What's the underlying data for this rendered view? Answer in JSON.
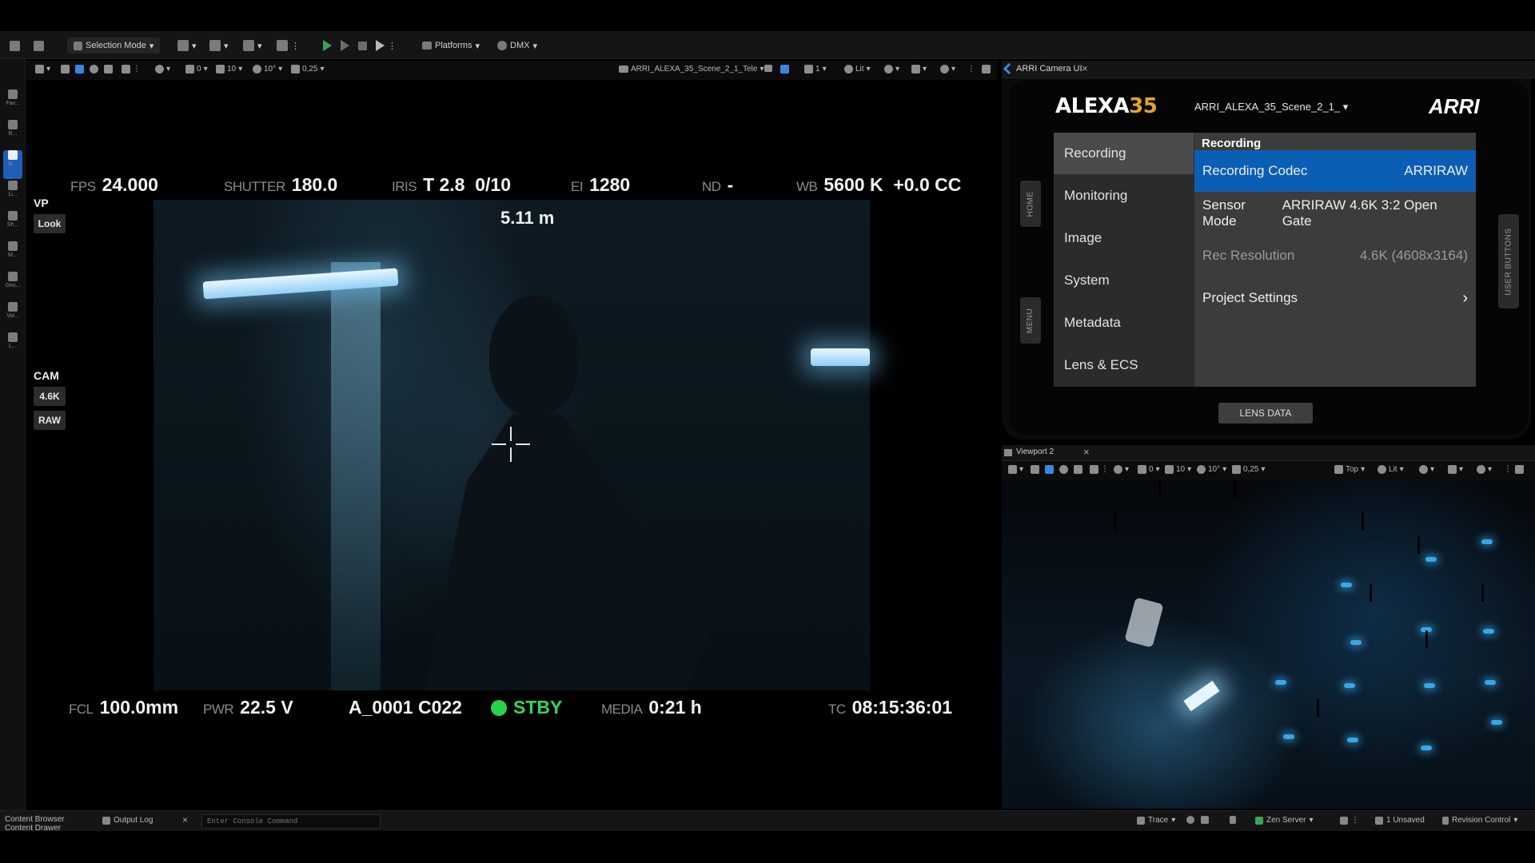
{
  "toolbar": {
    "selection_mode": "Selection Mode",
    "platforms": "Platforms",
    "dmx": "DMX"
  },
  "vp_toolbar": {
    "rot_snap": "0",
    "grid_snap": "10",
    "angle_snap": "10°",
    "scale_snap": "0,25",
    "camera": "ARRI_ALEXA_35_Scene_2_1_Tele",
    "speed": "1",
    "view_mode": "Lit"
  },
  "left_strip": [
    "Fav...",
    "R...",
    "B...",
    "Li...",
    "Sh...",
    "M...",
    "Geo...",
    "Vol...",
    "L..."
  ],
  "hud": {
    "fps_label": "FPS",
    "fps": "24.000",
    "shutter_label": "SHUTTER",
    "shutter": "180.0",
    "iris_label": "IRIS",
    "iris": "T 2.8  0/10",
    "ei_label": "EI",
    "ei": "1280",
    "nd_label": "ND",
    "nd": "-",
    "wb_label": "WB",
    "wb": "5600 K  +0.0 CC",
    "distance": "5.11 m",
    "fcl_label": "FCL",
    "fcl": "100.0mm",
    "pwr_label": "PWR",
    "pwr": "22.5 V",
    "clip": "A_0001 C022",
    "status": "STBY",
    "media_label": "MEDIA",
    "media": "0:21 h",
    "tc_label": "TC",
    "tc": "08:15:36:01",
    "vp_label": "VP",
    "look_btn": "Look",
    "cam_label": "CAM",
    "res_btn": "4.6K",
    "codec_btn": "RAW",
    "status_color": "#2bd14d",
    "status_text_color": "#35d656"
  },
  "arri_tab": {
    "title": "ARRI Camera UI",
    "close": "×"
  },
  "arri": {
    "logo_alexa": "ALEXA",
    "logo_num": "35",
    "scene": "ARRI_ALEXA_35_Scene_2_1_",
    "brand": "ARRI",
    "menu": [
      "Recording",
      "Monitoring",
      "Image",
      "System",
      "Metadata",
      "Lens & ECS"
    ],
    "section_title": "Recording",
    "rows": [
      {
        "label": "Recording Codec",
        "value": "ARRIRAW"
      },
      {
        "label": "Sensor Mode",
        "value": "ARRIRAW 4.6K 3:2 Open Gate"
      },
      {
        "label": "Rec Resolution",
        "value": "4.6K (4608x3164)"
      },
      {
        "label": "Project Settings",
        "value": "›"
      }
    ],
    "home_tab": "HOME",
    "menu_tab": "MENU",
    "user_tab": "USER BUTTONS",
    "lens_btn": "LENS DATA",
    "accent": "#0a5fb5",
    "logo_num_color": "#e0a52a"
  },
  "vp2": {
    "title": "Viewport 2",
    "close": "×",
    "rot_snap": "0",
    "grid_snap": "10",
    "angle_snap": "10°",
    "scale_snap": "0,25",
    "view": "Top",
    "view_mode": "Lit"
  },
  "status_bar": {
    "content_browser": "Content Browser",
    "content_drawer": "Content Drawer",
    "output_log": "Output Log",
    "close": "×",
    "console_placeholder": "Enter Console Command",
    "trace": "Trace",
    "zen": "Zen Server",
    "unsaved": "1 Unsaved",
    "revision": "Revision Control"
  }
}
